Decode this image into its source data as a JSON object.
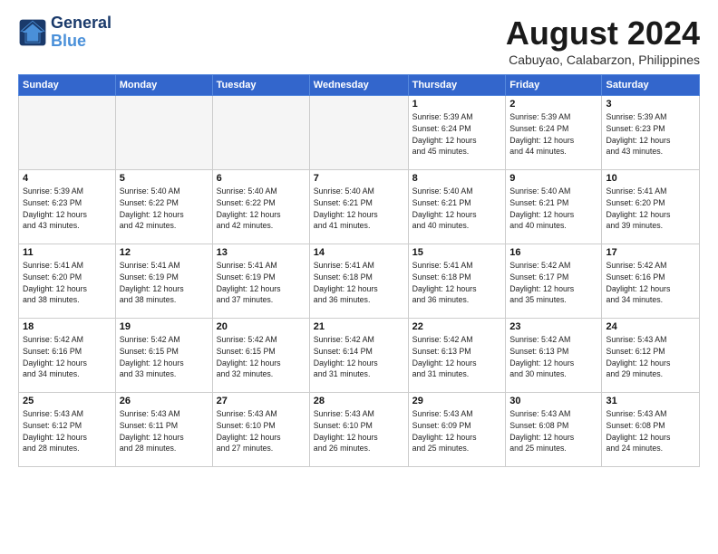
{
  "header": {
    "logo_line1": "General",
    "logo_line2": "Blue",
    "month_title": "August 2024",
    "subtitle": "Cabuyao, Calabarzon, Philippines"
  },
  "weekdays": [
    "Sunday",
    "Monday",
    "Tuesday",
    "Wednesday",
    "Thursday",
    "Friday",
    "Saturday"
  ],
  "weeks": [
    [
      {
        "day": "",
        "info": "",
        "empty": true
      },
      {
        "day": "",
        "info": "",
        "empty": true
      },
      {
        "day": "",
        "info": "",
        "empty": true
      },
      {
        "day": "",
        "info": "",
        "empty": true
      },
      {
        "day": "1",
        "info": "Sunrise: 5:39 AM\nSunset: 6:24 PM\nDaylight: 12 hours\nand 45 minutes."
      },
      {
        "day": "2",
        "info": "Sunrise: 5:39 AM\nSunset: 6:24 PM\nDaylight: 12 hours\nand 44 minutes."
      },
      {
        "day": "3",
        "info": "Sunrise: 5:39 AM\nSunset: 6:23 PM\nDaylight: 12 hours\nand 43 minutes."
      }
    ],
    [
      {
        "day": "4",
        "info": "Sunrise: 5:39 AM\nSunset: 6:23 PM\nDaylight: 12 hours\nand 43 minutes."
      },
      {
        "day": "5",
        "info": "Sunrise: 5:40 AM\nSunset: 6:22 PM\nDaylight: 12 hours\nand 42 minutes."
      },
      {
        "day": "6",
        "info": "Sunrise: 5:40 AM\nSunset: 6:22 PM\nDaylight: 12 hours\nand 42 minutes."
      },
      {
        "day": "7",
        "info": "Sunrise: 5:40 AM\nSunset: 6:21 PM\nDaylight: 12 hours\nand 41 minutes."
      },
      {
        "day": "8",
        "info": "Sunrise: 5:40 AM\nSunset: 6:21 PM\nDaylight: 12 hours\nand 40 minutes."
      },
      {
        "day": "9",
        "info": "Sunrise: 5:40 AM\nSunset: 6:21 PM\nDaylight: 12 hours\nand 40 minutes."
      },
      {
        "day": "10",
        "info": "Sunrise: 5:41 AM\nSunset: 6:20 PM\nDaylight: 12 hours\nand 39 minutes."
      }
    ],
    [
      {
        "day": "11",
        "info": "Sunrise: 5:41 AM\nSunset: 6:20 PM\nDaylight: 12 hours\nand 38 minutes."
      },
      {
        "day": "12",
        "info": "Sunrise: 5:41 AM\nSunset: 6:19 PM\nDaylight: 12 hours\nand 38 minutes."
      },
      {
        "day": "13",
        "info": "Sunrise: 5:41 AM\nSunset: 6:19 PM\nDaylight: 12 hours\nand 37 minutes."
      },
      {
        "day": "14",
        "info": "Sunrise: 5:41 AM\nSunset: 6:18 PM\nDaylight: 12 hours\nand 36 minutes."
      },
      {
        "day": "15",
        "info": "Sunrise: 5:41 AM\nSunset: 6:18 PM\nDaylight: 12 hours\nand 36 minutes."
      },
      {
        "day": "16",
        "info": "Sunrise: 5:42 AM\nSunset: 6:17 PM\nDaylight: 12 hours\nand 35 minutes."
      },
      {
        "day": "17",
        "info": "Sunrise: 5:42 AM\nSunset: 6:16 PM\nDaylight: 12 hours\nand 34 minutes."
      }
    ],
    [
      {
        "day": "18",
        "info": "Sunrise: 5:42 AM\nSunset: 6:16 PM\nDaylight: 12 hours\nand 34 minutes."
      },
      {
        "day": "19",
        "info": "Sunrise: 5:42 AM\nSunset: 6:15 PM\nDaylight: 12 hours\nand 33 minutes."
      },
      {
        "day": "20",
        "info": "Sunrise: 5:42 AM\nSunset: 6:15 PM\nDaylight: 12 hours\nand 32 minutes."
      },
      {
        "day": "21",
        "info": "Sunrise: 5:42 AM\nSunset: 6:14 PM\nDaylight: 12 hours\nand 31 minutes."
      },
      {
        "day": "22",
        "info": "Sunrise: 5:42 AM\nSunset: 6:13 PM\nDaylight: 12 hours\nand 31 minutes."
      },
      {
        "day": "23",
        "info": "Sunrise: 5:42 AM\nSunset: 6:13 PM\nDaylight: 12 hours\nand 30 minutes."
      },
      {
        "day": "24",
        "info": "Sunrise: 5:43 AM\nSunset: 6:12 PM\nDaylight: 12 hours\nand 29 minutes."
      }
    ],
    [
      {
        "day": "25",
        "info": "Sunrise: 5:43 AM\nSunset: 6:12 PM\nDaylight: 12 hours\nand 28 minutes."
      },
      {
        "day": "26",
        "info": "Sunrise: 5:43 AM\nSunset: 6:11 PM\nDaylight: 12 hours\nand 28 minutes."
      },
      {
        "day": "27",
        "info": "Sunrise: 5:43 AM\nSunset: 6:10 PM\nDaylight: 12 hours\nand 27 minutes."
      },
      {
        "day": "28",
        "info": "Sunrise: 5:43 AM\nSunset: 6:10 PM\nDaylight: 12 hours\nand 26 minutes."
      },
      {
        "day": "29",
        "info": "Sunrise: 5:43 AM\nSunset: 6:09 PM\nDaylight: 12 hours\nand 25 minutes."
      },
      {
        "day": "30",
        "info": "Sunrise: 5:43 AM\nSunset: 6:08 PM\nDaylight: 12 hours\nand 25 minutes."
      },
      {
        "day": "31",
        "info": "Sunrise: 5:43 AM\nSunset: 6:08 PM\nDaylight: 12 hours\nand 24 minutes."
      }
    ]
  ]
}
